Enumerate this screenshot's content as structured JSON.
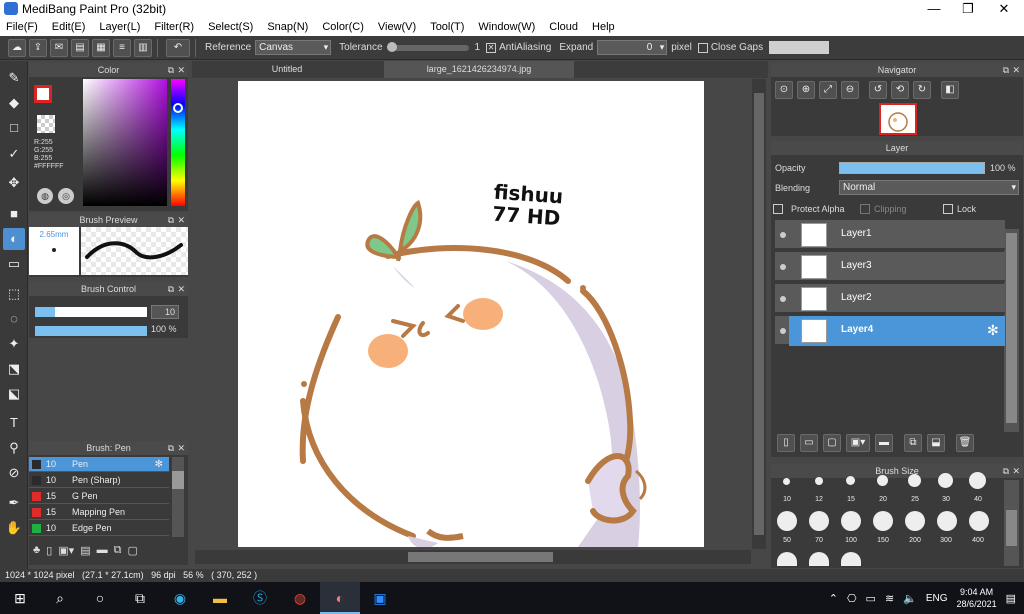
{
  "window": {
    "title": "MediBang Paint Pro (32bit)",
    "minimize": "—",
    "maximize": "❐",
    "close": "✕"
  },
  "menu": [
    "File(F)",
    "Edit(E)",
    "Layer(L)",
    "Filter(R)",
    "Select(S)",
    "Snap(N)",
    "Color(C)",
    "View(V)",
    "Tool(T)",
    "Window(W)",
    "Cloud",
    "Help"
  ],
  "toolbar": {
    "reference_label": "Reference",
    "reference_value": "Canvas",
    "tolerance_label": "Tolerance",
    "tolerance_value": "1",
    "antialiasing_label": "AntiAliasing",
    "expand_label": "Expand",
    "expand_value": "0",
    "expand_unit": "pixel",
    "close_gaps_label": "Close Gaps"
  },
  "color_panel": {
    "title": "Color",
    "r": "R:255",
    "g": "G:255",
    "b": "B:255",
    "hex": "#FFFFFF"
  },
  "brush_preview": {
    "title": "Brush Preview",
    "size": "2.65mm"
  },
  "brush_control": {
    "title": "Brush Control",
    "size_value": "10",
    "opacity_value": "100 %"
  },
  "brush_panel": {
    "title": "Brush: Pen",
    "items": [
      {
        "size": "10",
        "name": "Pen",
        "color": "#2b2b2b"
      },
      {
        "size": "10",
        "name": "Pen (Sharp)",
        "color": "#2b2b2b"
      },
      {
        "size": "15",
        "name": "G Pen",
        "color": "#e02b2b"
      },
      {
        "size": "15",
        "name": "Mapping Pen",
        "color": "#e02b2b"
      },
      {
        "size": "10",
        "name": "Edge Pen",
        "color": "#20b040"
      }
    ]
  },
  "tabs": [
    {
      "label": "Untitled"
    },
    {
      "label": "large_1621426234974.jpg"
    }
  ],
  "canvas_text": {
    "line1": "fishuu",
    "line2": "77 HD"
  },
  "navigator": {
    "title": "Navigator"
  },
  "layer_panel": {
    "title": "Layer",
    "opacity_label": "Opacity",
    "opacity_value": "100 %",
    "blending_label": "Blending",
    "blending_value": "Normal",
    "protect_alpha": "Protect Alpha",
    "clipping": "Clipping",
    "lock": "Lock",
    "layers": [
      {
        "name": "Layer1"
      },
      {
        "name": "Layer3"
      },
      {
        "name": "Layer2"
      },
      {
        "name": "Layer4"
      }
    ],
    "selected_layer": "Layer4"
  },
  "brush_size": {
    "title": "Brush Size",
    "sizes": [
      "10",
      "12",
      "15",
      "20",
      "25",
      "30",
      "40",
      "50",
      "70",
      "100",
      "150",
      "200",
      "300",
      "400"
    ]
  },
  "status": {
    "text": "1024 * 1024 pixel   (27.1 * 27.1cm)   96 dpi   56 %   ( 370, 252 )"
  },
  "taskbar": {
    "language": "ENG",
    "time": "9:04 AM",
    "date": "28/6/2021"
  },
  "colors": {
    "accent": "#4b95d9",
    "panel": "#3a3a3a",
    "brown_stroke": "#b87a45",
    "leaf": "#7ec88a",
    "cheek": "#f8b07a",
    "shadow": "#d8cfe2"
  }
}
